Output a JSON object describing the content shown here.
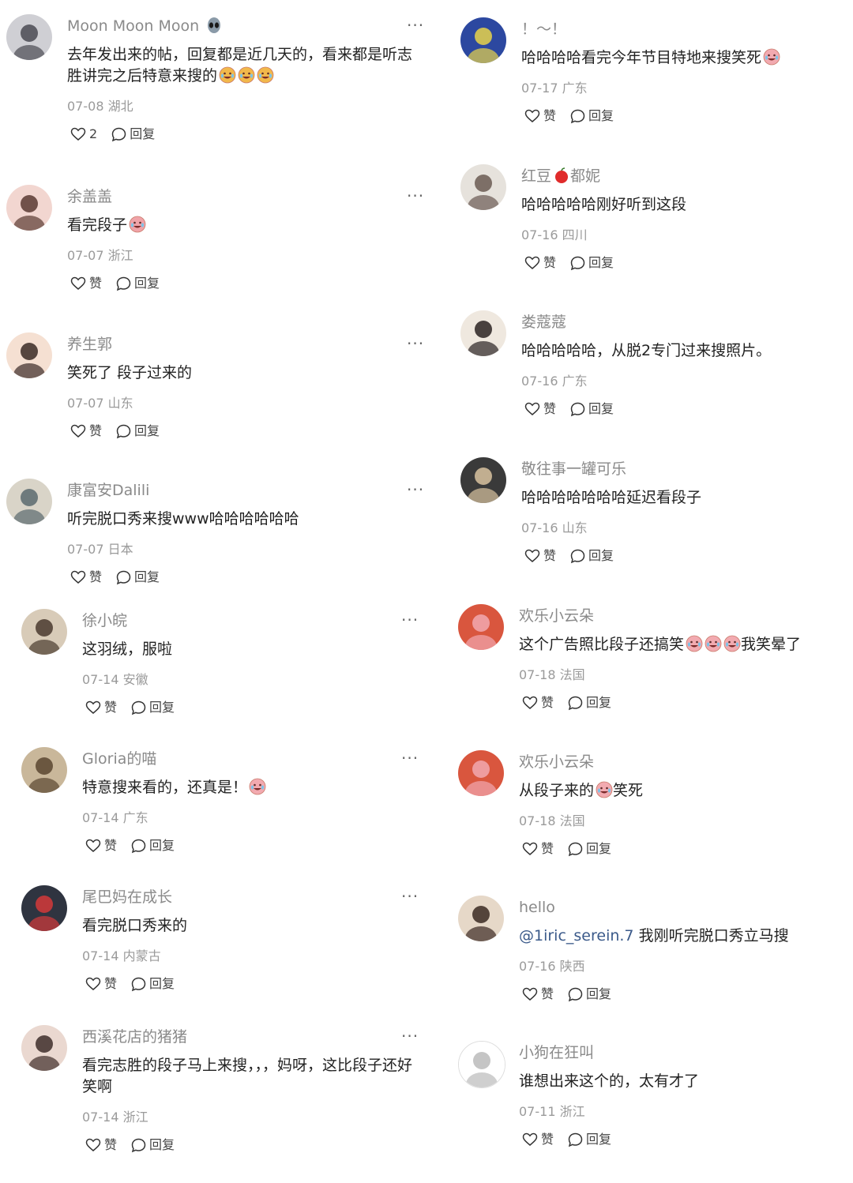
{
  "comments": [
    {
      "user": "Moon Moon Moon",
      "text": "去年发出来的帖，回复都是近几天的，看来都是听志胜讲完之后特意来搜的",
      "emoji_count": 3,
      "emoji": "grin-face-emoji",
      "date": "07-08",
      "location": "湖北",
      "like_label": "2",
      "reply_label": "回复"
    },
    {
      "user": "余盖盖",
      "text": "看完段子",
      "emoji_count": 1,
      "emoji": "laughing-face-emoji",
      "date": "07-07",
      "location": "浙江",
      "like_label": "赞",
      "reply_label": "回复"
    },
    {
      "user": "养生郭",
      "text": "笑死了 段子过来的",
      "emoji_count": 0,
      "date": "07-07",
      "location": "山东",
      "like_label": "赞",
      "reply_label": "回复"
    },
    {
      "user": "康富安Dalili",
      "text": "听完脱口秀来搜www哈哈哈哈哈哈",
      "emoji_count": 0,
      "date": "07-07",
      "location": "日本",
      "like_label": "赞",
      "reply_label": "回复"
    },
    {
      "user": "徐小皖",
      "text": "这羽绒，服啦",
      "emoji_count": 0,
      "date": "07-14",
      "location": "安徽",
      "like_label": "赞",
      "reply_label": "回复"
    },
    {
      "user": "Gloria的喵",
      "text": "特意搜来看的，还真是！",
      "emoji_count": 1,
      "emoji": "crying-laughing-emoji",
      "date": "07-14",
      "location": "广东",
      "like_label": "赞",
      "reply_label": "回复"
    },
    {
      "user": "尾巴妈在成长",
      "text": "看完脱口秀来的",
      "emoji_count": 0,
      "date": "07-14",
      "location": "内蒙古",
      "like_label": "赞",
      "reply_label": "回复"
    },
    {
      "user": "西溪花店的猪猪",
      "text": "看完志胜的段子马上来搜，，，妈呀，这比段子还好笑啊",
      "emoji_count": 0,
      "date": "07-14",
      "location": "浙江",
      "like_label": "赞",
      "reply_label": "回复"
    },
    {
      "user": "！～！",
      "text": "哈哈哈哈看完今年节目特地来搜笑死",
      "emoji_count": 1,
      "emoji": "crying-laughing-emoji",
      "date": "07-17",
      "location": "广东",
      "like_label": "赞",
      "reply_label": "回复"
    },
    {
      "user": "红豆",
      "user_suffix": "都妮",
      "user_emoji": "apple-emoji",
      "text": "哈哈哈哈哈刚好听到这段",
      "emoji_count": 0,
      "date": "07-16",
      "location": "四川",
      "like_label": "赞",
      "reply_label": "回复"
    },
    {
      "user": "娄蔻蔻",
      "text": "哈哈哈哈哈，从脱2专门过来搜照片。",
      "emoji_count": 0,
      "date": "07-16",
      "location": "广东",
      "like_label": "赞",
      "reply_label": "回复"
    },
    {
      "user": "敬往事一罐可乐",
      "text": "哈哈哈哈哈哈哈延迟看段子",
      "emoji_count": 0,
      "date": "07-16",
      "location": "山东",
      "like_label": "赞",
      "reply_label": "回复"
    },
    {
      "user": "欢乐小云朵",
      "text": "这个广告照比段子还搞笑",
      "text_after": "我笑晕了",
      "emoji_count": 3,
      "emoji": "crying-laughing-emoji",
      "date": "07-18",
      "location": "法国",
      "like_label": "赞",
      "reply_label": "回复"
    },
    {
      "user": "欢乐小云朵",
      "text": "从段子来的",
      "text_after": "笑死",
      "emoji_count": 1,
      "emoji": "crying-laughing-emoji",
      "date": "07-18",
      "location": "法国",
      "like_label": "赞",
      "reply_label": "回复"
    },
    {
      "user": "hello",
      "mention": "@1iric_serein.7",
      "text": " 我刚听完脱口秀立马搜",
      "emoji_count": 0,
      "date": "07-16",
      "location": "陕西",
      "like_label": "赞",
      "reply_label": "回复"
    },
    {
      "user": "小狗在狂叫",
      "text": "谁想出来这个的，太有才了",
      "emoji_count": 0,
      "date": "07-11",
      "location": "浙江",
      "like_label": "赞",
      "reply_label": "回复"
    }
  ],
  "more_label": "···",
  "colors": {
    "text": "#222222",
    "muted": "#8a8a8a",
    "meta": "#9a9a9a",
    "mention": "#3b5a8a"
  }
}
